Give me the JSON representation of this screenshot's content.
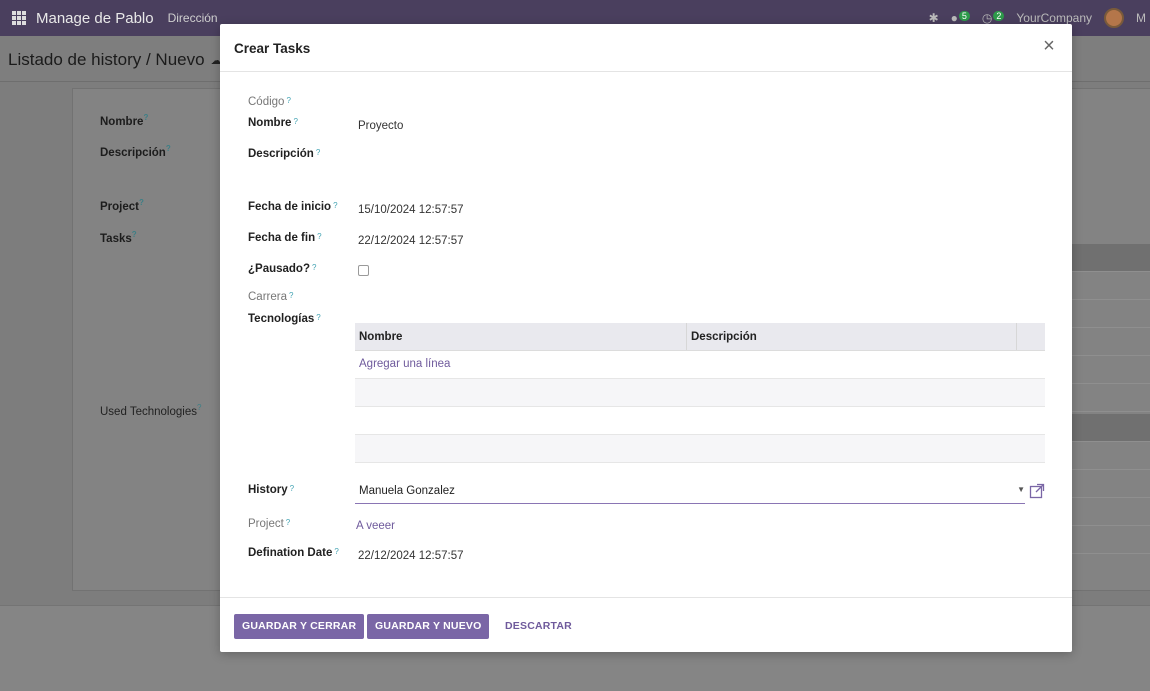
{
  "navbar": {
    "brand": "Manage de Pablo",
    "menu_item": "Dirección",
    "messages_count": "5",
    "activities_count": "2",
    "company": "YourCompany",
    "user_initial": "M"
  },
  "breadcrumb": {
    "text": "Listado de history / Nuevo"
  },
  "background_form": {
    "labels": {
      "nombre": "Nombre",
      "descripcion": "Descripción",
      "project": "Project",
      "tasks": "Tasks",
      "used_technologies": "Used Technologies"
    },
    "help_mark": "?"
  },
  "modal": {
    "title": "Crear Tasks",
    "close": "×",
    "fields": {
      "codigo_label": "Código",
      "nombre_label": "Nombre",
      "nombre_value": "Proyecto",
      "descripcion_label": "Descripción",
      "fecha_inicio_label": "Fecha de inicio",
      "fecha_inicio_value": "15/10/2024 12:57:57",
      "fecha_fin_label": "Fecha de fin",
      "fecha_fin_value": "22/12/2024 12:57:57",
      "pausado_label": "¿Pausado?",
      "pausado_checked": false,
      "carrera_label": "Carrera",
      "tecnologias_label": "Tecnologías",
      "history_label": "History",
      "history_value": "Manuela Gonzalez",
      "project_label": "Project",
      "project_value": "A veeer",
      "defination_date_label": "Defination Date",
      "defination_date_value": "22/12/2024 12:57:57"
    },
    "table": {
      "columns": [
        "Nombre",
        "Descripción"
      ],
      "add_line": "Agregar una línea"
    },
    "help_mark": "?",
    "buttons": {
      "save_close": "GUARDAR Y CERRAR",
      "save_new": "GUARDAR Y NUEVO",
      "discard": "DESCARTAR"
    }
  },
  "colors": {
    "navbar": "#4a3f5e",
    "primary_button": "#7a66a6",
    "link": "#6f5a9c",
    "help_mark": "#41a2b2"
  }
}
